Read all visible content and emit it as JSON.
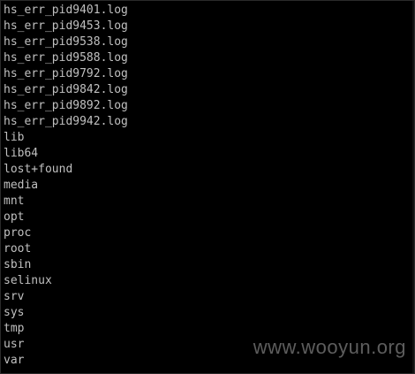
{
  "terminal": {
    "lines": [
      "hs_err_pid9401.log",
      "hs_err_pid9453.log",
      "hs_err_pid9538.log",
      "hs_err_pid9588.log",
      "hs_err_pid9792.log",
      "hs_err_pid9842.log",
      "hs_err_pid9892.log",
      "hs_err_pid9942.log",
      "lib",
      "lib64",
      "lost+found",
      "media",
      "mnt",
      "opt",
      "proc",
      "root",
      "sbin",
      "selinux",
      "srv",
      "sys",
      "tmp",
      "usr",
      "var"
    ],
    "text_color": "#c0c0c0",
    "background_color": "#000000"
  },
  "watermark": {
    "text": "www.wooyun.org"
  }
}
